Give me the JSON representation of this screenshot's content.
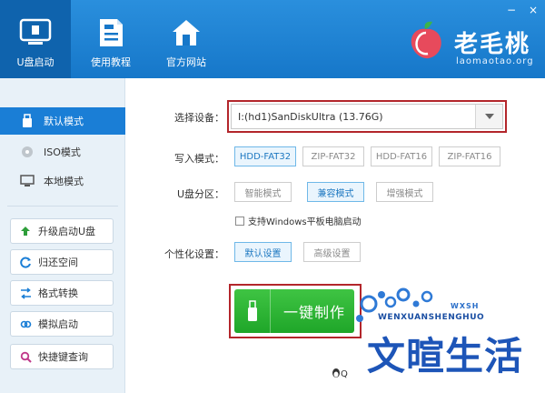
{
  "header": {
    "nav": [
      {
        "label": "U盘启动",
        "icon": "usb-monitor-icon"
      },
      {
        "label": "使用教程",
        "icon": "document-icon"
      },
      {
        "label": "官方网站",
        "icon": "home-icon"
      }
    ],
    "logo": {
      "name": "老毛桃",
      "domain": "laomaotao.org",
      "icon": "peach-logo-icon"
    },
    "window_controls": {
      "minimize": "−",
      "close": "×"
    }
  },
  "sidebar": {
    "modes": [
      {
        "label": "默认模式",
        "icon": "usb-drive-icon",
        "active": true
      },
      {
        "label": "ISO模式",
        "icon": "disc-icon",
        "active": false
      },
      {
        "label": "本地模式",
        "icon": "monitor-icon",
        "active": false
      }
    ],
    "tools": [
      {
        "label": "升级启动U盘",
        "icon": "arrow-up-icon",
        "color": "#2e9e3a"
      },
      {
        "label": "归还空间",
        "icon": "refresh-icon",
        "color": "#1a7ed6"
      },
      {
        "label": "格式转换",
        "icon": "convert-icon",
        "color": "#1a7ed6"
      },
      {
        "label": "模拟启动",
        "icon": "link-icon",
        "color": "#1a7ed6"
      },
      {
        "label": "快捷键查询",
        "icon": "search-icon",
        "color": "#c0398a"
      }
    ]
  },
  "main": {
    "device": {
      "label": "选择设备：",
      "value": "I:(hd1)SanDiskUltra (13.76G)"
    },
    "write_mode": {
      "label": "写入模式：",
      "options": [
        "HDD-FAT32",
        "ZIP-FAT32",
        "HDD-FAT16",
        "ZIP-FAT16"
      ],
      "selected": "HDD-FAT32"
    },
    "partition": {
      "label": "U盘分区：",
      "options": [
        "智能模式",
        "兼容模式",
        "增强模式"
      ],
      "selected": "兼容模式"
    },
    "tablet_boot": {
      "label": "支持Windows平板电脑启动",
      "checked": false
    },
    "personalize": {
      "label": "个性化设置：",
      "options": [
        "默认设置",
        "高级设置"
      ],
      "selected": "默认设置"
    },
    "start_button": "一键制作",
    "qq_tip": "Q"
  },
  "watermark": {
    "tag": "WXSH",
    "english": "WENXUANSHENGHUO",
    "chinese": "文暄生活"
  },
  "colors": {
    "header_blue": "#1677c9",
    "active_blue": "#1a7ed6",
    "highlight_red": "#b3262b",
    "start_green": "#2fb437"
  }
}
